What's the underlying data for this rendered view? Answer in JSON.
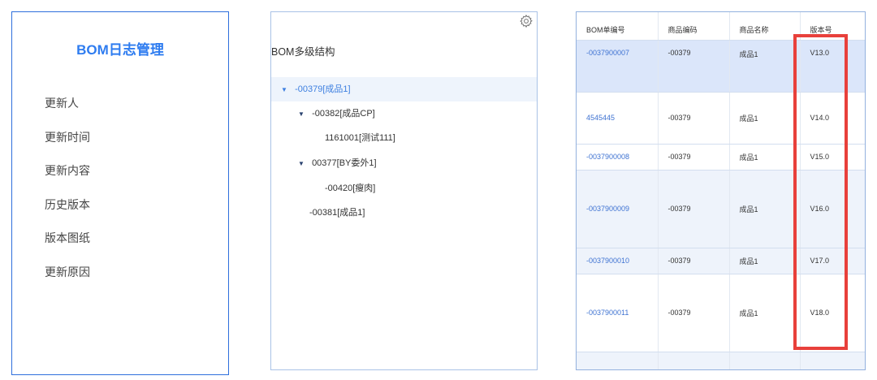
{
  "log_panel": {
    "title": "BOM日志管理",
    "items": [
      {
        "label": "更新人"
      },
      {
        "label": "更新时间"
      },
      {
        "label": "更新内容"
      },
      {
        "label": "历史版本"
      },
      {
        "label": "版本图纸"
      },
      {
        "label": "更新原因"
      }
    ]
  },
  "tree_panel": {
    "title": "BOM多级结构",
    "settings_icon": "gear-icon",
    "nodes": [
      {
        "label": "-00379[成品1]",
        "expanded": true,
        "selected": true
      },
      {
        "label": "-00382[成品CP]",
        "expanded": true
      },
      {
        "label": "1161001[测试111]"
      },
      {
        "label": "00377[BY委外1]",
        "expanded": true
      },
      {
        "label": "-00420[瘦肉]"
      },
      {
        "label": "-00381[成品1]"
      }
    ],
    "caret_glyph": "▼"
  },
  "bom_table": {
    "columns": [
      "BOM单编号",
      "商品编码",
      "商品名称",
      "版本号"
    ],
    "rows": [
      {
        "bom_no": "-0037900007",
        "code": "-00379",
        "name": "成品1",
        "version": "V13.0"
      },
      {
        "bom_no": "4545445",
        "code": "-00379",
        "name": "成品1",
        "version": "V14.0"
      },
      {
        "bom_no": "-0037900008",
        "code": "-00379",
        "name": "成品1",
        "version": "V15.0"
      },
      {
        "bom_no": "-0037900009",
        "code": "-00379",
        "name": "成品1",
        "version": "V16.0"
      },
      {
        "bom_no": "-0037900010",
        "code": "-00379",
        "name": "成品1",
        "version": "V17.0"
      },
      {
        "bom_no": "-0037900011",
        "code": "-00379",
        "name": "成品1",
        "version": "V18.0"
      }
    ],
    "highlight_color": "#e8403b"
  }
}
